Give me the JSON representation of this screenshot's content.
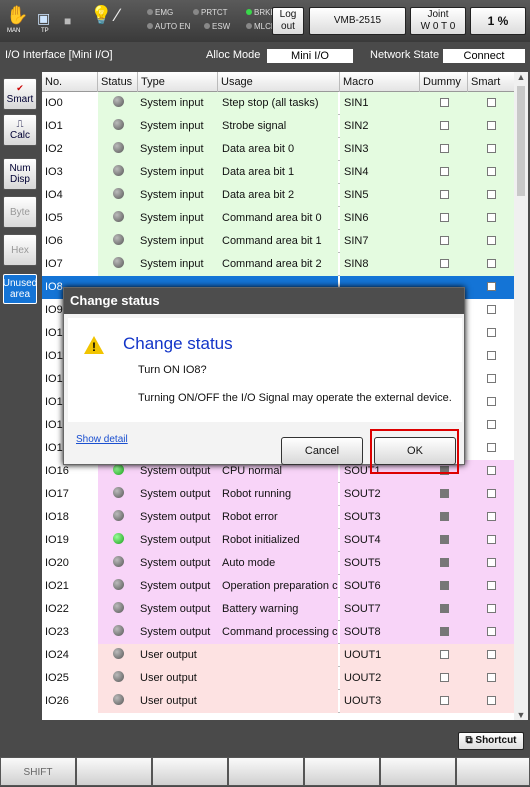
{
  "topbar": {
    "man_label": "MAN",
    "tp_label": "TP",
    "indicators": [
      {
        "label": "EMG",
        "on": false
      },
      {
        "label": "PRTCT",
        "on": false
      },
      {
        "label": "BRKE",
        "on": true
      },
      {
        "label": "AUTO EN",
        "on": false
      },
      {
        "label": "ESW",
        "on": false
      },
      {
        "label": "MLCK",
        "on": false
      }
    ],
    "logout_line1": "Log",
    "logout_line2": "out",
    "robot_model": "VMB-2515",
    "joint_line1": "Joint",
    "joint_line2": "W 0 T 0",
    "speed": "1 %"
  },
  "infobar": {
    "title": "I/O Interface [Mini I/O]",
    "alloc_label": "Alloc Mode",
    "alloc_value": "Mini I/O",
    "network_label": "Network State",
    "network_value": "Connect"
  },
  "sidebar": {
    "smart": "Smart",
    "calc": "Calc",
    "num_line1": "Num",
    "num_line2": "Disp",
    "byte": "Byte",
    "hex": "Hex",
    "unused_line1": "Unused",
    "unused_line2": "area"
  },
  "table": {
    "headers": [
      "No.",
      "Status",
      "Type",
      "Usage",
      "Macro",
      "Dummy",
      "Smart"
    ],
    "rows": [
      {
        "no": "IO0",
        "on": false,
        "type": "System input",
        "usage": "Step stop (all tasks)",
        "macro": "SIN1",
        "bg": "#e4fbe0",
        "dummy_fill": false
      },
      {
        "no": "IO1",
        "on": false,
        "type": "System input",
        "usage": "Strobe signal",
        "macro": "SIN2",
        "bg": "#e4fbe0",
        "dummy_fill": false
      },
      {
        "no": "IO2",
        "on": false,
        "type": "System input",
        "usage": "Data area bit 0",
        "macro": "SIN3",
        "bg": "#e4fbe0",
        "dummy_fill": false
      },
      {
        "no": "IO3",
        "on": false,
        "type": "System input",
        "usage": "Data area bit 1",
        "macro": "SIN4",
        "bg": "#e4fbe0",
        "dummy_fill": false
      },
      {
        "no": "IO4",
        "on": false,
        "type": "System input",
        "usage": "Data area bit 2",
        "macro": "SIN5",
        "bg": "#e4fbe0",
        "dummy_fill": false
      },
      {
        "no": "IO5",
        "on": false,
        "type": "System input",
        "usage": "Command area  bit 0",
        "macro": "SIN6",
        "bg": "#e4fbe0",
        "dummy_fill": false
      },
      {
        "no": "IO6",
        "on": false,
        "type": "System input",
        "usage": "Command area  bit 1",
        "macro": "SIN7",
        "bg": "#e4fbe0",
        "dummy_fill": false
      },
      {
        "no": "IO7",
        "on": false,
        "type": "System input",
        "usage": "Command area  bit 2",
        "macro": "SIN8",
        "bg": "#e4fbe0",
        "dummy_fill": false
      },
      {
        "no": "IO8",
        "on": false,
        "type": "",
        "usage": "",
        "macro": "",
        "bg": "#1474d6",
        "dummy_fill": false
      },
      {
        "no": "IO9",
        "on": false,
        "type": "",
        "usage": "",
        "macro": "",
        "bg": "#ffffff",
        "dummy_fill": false
      },
      {
        "no": "IO10",
        "on": false,
        "type": "",
        "usage": "",
        "macro": "",
        "bg": "#ffffff",
        "dummy_fill": false
      },
      {
        "no": "IO11",
        "on": false,
        "type": "",
        "usage": "",
        "macro": "",
        "bg": "#ffffff",
        "dummy_fill": false
      },
      {
        "no": "IO12",
        "on": false,
        "type": "",
        "usage": "",
        "macro": "",
        "bg": "#ffffff",
        "dummy_fill": false
      },
      {
        "no": "IO13",
        "on": false,
        "type": "",
        "usage": "",
        "macro": "",
        "bg": "#ffffff",
        "dummy_fill": false
      },
      {
        "no": "IO14",
        "on": false,
        "type": "",
        "usage": "",
        "macro": "",
        "bg": "#ffffff",
        "dummy_fill": false
      },
      {
        "no": "IO15",
        "on": false,
        "type": "",
        "usage": "",
        "macro": "",
        "bg": "#ffffff",
        "dummy_fill": false
      },
      {
        "no": "IO16",
        "on": true,
        "type": "System output",
        "usage": "CPU normal",
        "macro": "SOUT1",
        "bg": "#f8d4f8",
        "dummy_fill": true
      },
      {
        "no": "IO17",
        "on": false,
        "type": "System output",
        "usage": "Robot running",
        "macro": "SOUT2",
        "bg": "#f8d4f8",
        "dummy_fill": true
      },
      {
        "no": "IO18",
        "on": false,
        "type": "System output",
        "usage": "Robot error",
        "macro": "SOUT3",
        "bg": "#f8d4f8",
        "dummy_fill": true
      },
      {
        "no": "IO19",
        "on": true,
        "type": "System output",
        "usage": "Robot initialized",
        "macro": "SOUT4",
        "bg": "#f8d4f8",
        "dummy_fill": true
      },
      {
        "no": "IO20",
        "on": false,
        "type": "System output",
        "usage": "Auto mode",
        "macro": "SOUT5",
        "bg": "#f8d4f8",
        "dummy_fill": true
      },
      {
        "no": "IO21",
        "on": false,
        "type": "System output",
        "usage": "Operation preparation co",
        "macro": "SOUT6",
        "bg": "#f8d4f8",
        "dummy_fill": true
      },
      {
        "no": "IO22",
        "on": false,
        "type": "System output",
        "usage": "Battery warning",
        "macro": "SOUT7",
        "bg": "#f8d4f8",
        "dummy_fill": true
      },
      {
        "no": "IO23",
        "on": false,
        "type": "System output",
        "usage": "Command processing co",
        "macro": "SOUT8",
        "bg": "#f8d4f8",
        "dummy_fill": true
      },
      {
        "no": "IO24",
        "on": false,
        "type": "User output",
        "usage": "",
        "macro": "UOUT1",
        "bg": "#fde2e2",
        "dummy_fill": false
      },
      {
        "no": "IO25",
        "on": false,
        "type": "User output",
        "usage": "",
        "macro": "UOUT2",
        "bg": "#fde2e2",
        "dummy_fill": false
      },
      {
        "no": "IO26",
        "on": false,
        "type": "User output",
        "usage": "",
        "macro": "UOUT3",
        "bg": "#fde2e2",
        "dummy_fill": false
      }
    ]
  },
  "dialog": {
    "title": "Change status",
    "heading": "Change status",
    "message1": "Turn ON IO8?",
    "message2": "Turning ON/OFF the I/O Signal may operate the external device.",
    "show_detail": "Show detail",
    "cancel": "Cancel",
    "ok": "OK"
  },
  "bottom": {
    "shortcut": "Shortcut",
    "shift": "SHIFT"
  },
  "colors": {
    "input_row": "#e4fbe0",
    "output_row": "#f8d4f8",
    "user_output_row": "#fde2e2",
    "selected_row": "#1474d6",
    "dialog_heading": "#1234c8",
    "ok_highlight": "#dd0000"
  }
}
